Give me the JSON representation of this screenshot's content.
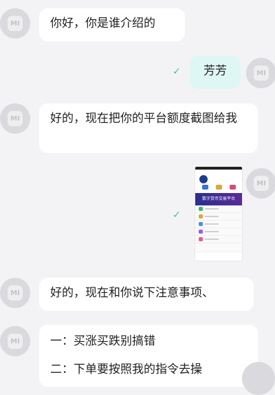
{
  "avatar_label": "MI",
  "messages": [
    {
      "from": "other",
      "text": "你好，你是谁介绍的"
    },
    {
      "from": "me",
      "text": "芳芳"
    },
    {
      "from": "other",
      "text": "好的，现在把你的平台额度截图给我"
    },
    {
      "from": "me",
      "type": "image",
      "caption": "数字货币交易平台"
    },
    {
      "from": "other",
      "text": "好的，现在和你说下注意事项、"
    },
    {
      "from": "other",
      "text": "一：买涨买跌别搞错"
    },
    {
      "from": "other",
      "text": "二：下单要按照我的指令去操"
    }
  ],
  "icons": {
    "read_receipt": "check-icon",
    "avatar": "mi-logo-icon"
  },
  "colors": {
    "background": "#f3f3f5",
    "my_bubble": "#dff7f4",
    "other_bubble": "#ffffff",
    "check": "#38c59c"
  }
}
